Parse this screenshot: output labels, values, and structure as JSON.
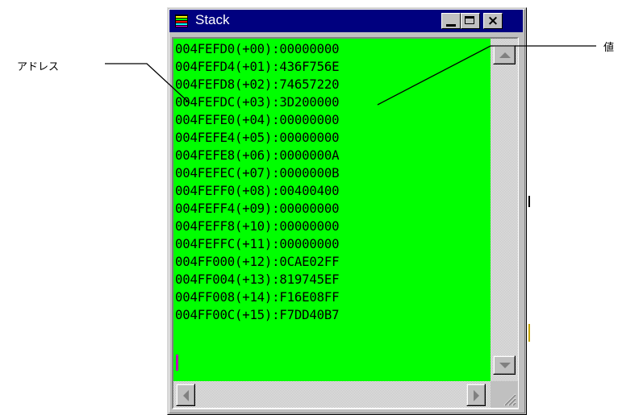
{
  "callouts": {
    "address": "アドレス",
    "value": "値"
  },
  "window": {
    "title": "Stack",
    "icon": "stack-window-icon",
    "buttons": {
      "minimize": "minimize-icon",
      "maximize": "maximize-icon",
      "close": "×"
    }
  },
  "stack_lines": [
    "004FEFD0(+00):00000000",
    "004FEFD4(+01):436F756E",
    "004FEFD8(+02):74657220",
    "004FEFDC(+03):3D200000",
    "004FEFE0(+04):00000000",
    "004FEFE4(+05):00000000",
    "004FEFE8(+06):0000000A",
    "004FEFEC(+07):0000000B",
    "004FEFF0(+08):00400400",
    "004FEFF4(+09):00000000",
    "004FEFF8(+10):00000000",
    "004FEFFC(+11):00000000",
    "004FF000(+12):0CAE02FF",
    "004FF004(+13):819745EF",
    "004FF008(+14):F16E08FF",
    "004FF00C(+15):F7DD40B7"
  ],
  "colors": {
    "content_background": "#00ff00",
    "titlebar": "#00007f",
    "cursor": "#c000c0"
  }
}
